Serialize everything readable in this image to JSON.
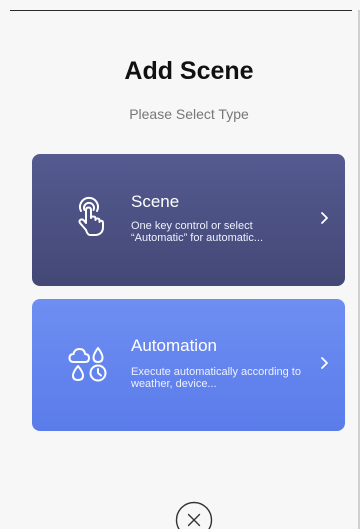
{
  "header": {
    "title": "Add Scene",
    "subtitle": "Please Select Type"
  },
  "cards": [
    {
      "title": "Scene",
      "description": "One key control or select “Automatic” for automatic...",
      "icon": "tap-hand-icon",
      "color": "#4b5082"
    },
    {
      "title": "Automation",
      "description": "Execute automatically according to weather, device...",
      "icon": "weather-clock-icon",
      "color": "#6284ee"
    }
  ],
  "close": {
    "icon": "close-icon"
  }
}
